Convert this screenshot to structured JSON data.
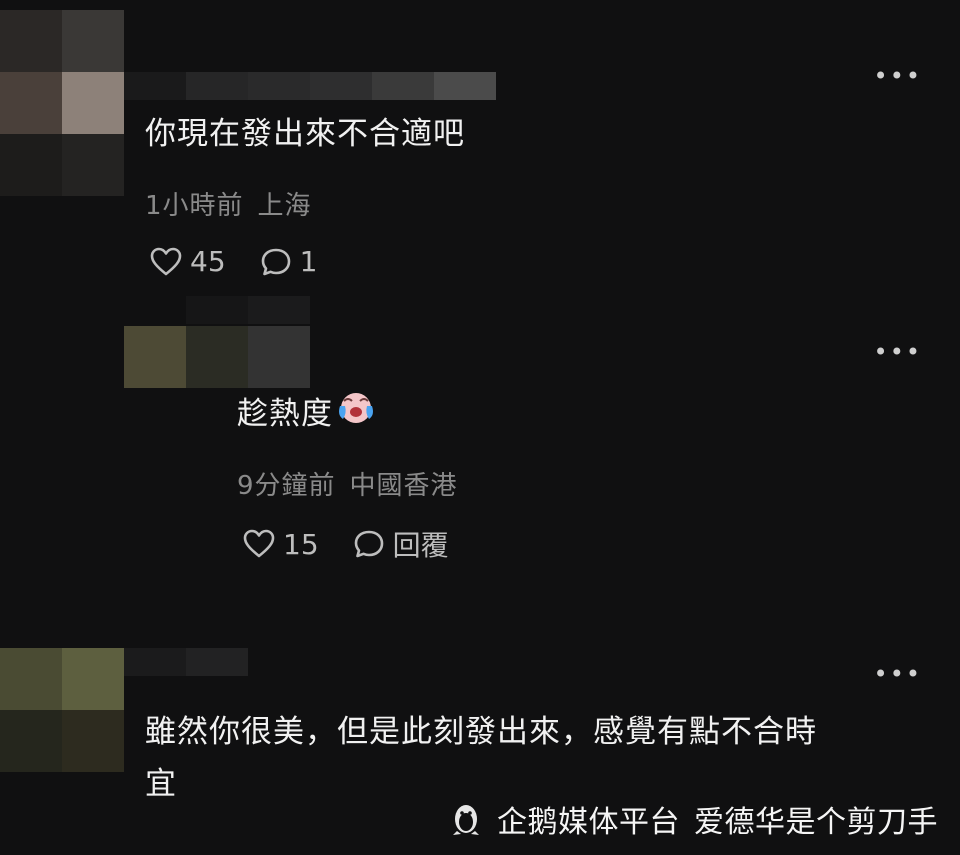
{
  "comments": [
    {
      "text": "你現在發出來不合適吧",
      "time": "1小時前",
      "location": "上海",
      "likes": "45",
      "replies": "1",
      "more": "•••"
    },
    {
      "text": "趁熱度",
      "emoji": "crying-face",
      "time": "9分鐘前",
      "location": "中國香港",
      "likes": "15",
      "reply_label": "回覆",
      "more": "•••"
    },
    {
      "text_line1": "雖然你很美，但是此刻發出來，感覺有點不合時",
      "text_line2": "宜",
      "more": "•••"
    }
  ],
  "watermark": {
    "platform": "企鹅媒体平台",
    "author": "爱德华是个剪刀手"
  },
  "colors": {
    "background": "#101011",
    "text": "#f1f1f1",
    "meta": "#8a8a8a"
  }
}
